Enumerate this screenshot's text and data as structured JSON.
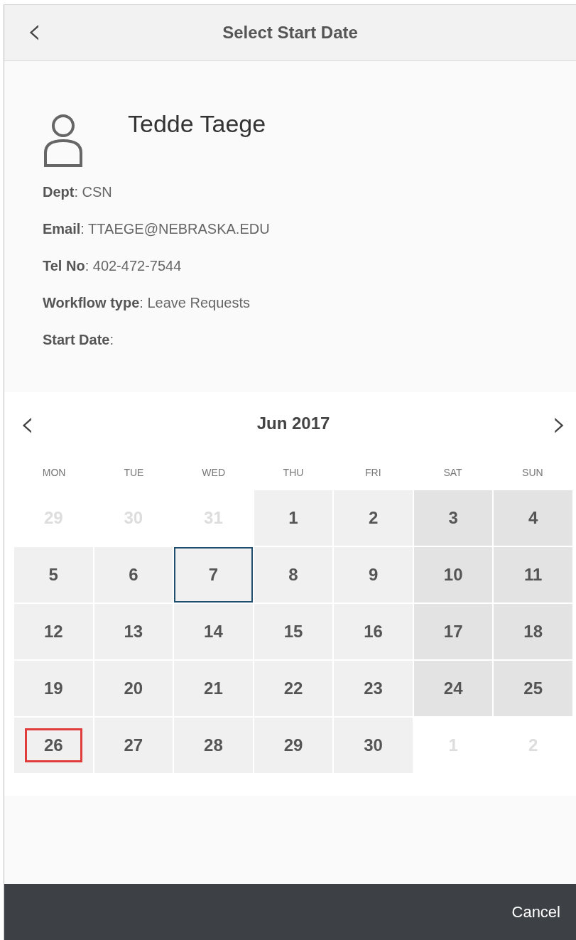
{
  "header": {
    "back": "‹",
    "title": "Select Start Date"
  },
  "profile": {
    "name": "Tedde Taege",
    "fields": [
      {
        "text": "**Dept**: CSN"
      },
      {
        "text": "**Email**: TTAEGE@NEBRASKA.EDU"
      },
      {
        "text": "**Tel No**: 402-472-7544"
      },
      {
        "text": "**Workflow type**: Leave Requests"
      },
      {
        "text": "**Start Date**:"
      }
    ]
  },
  "calendar": {
    "prev": "‹",
    "title": "Jun 2017",
    "next": "›",
    "weekdays": [
      "MON",
      "TUE",
      "WED",
      "THU",
      "FRI",
      "SAT",
      "SUN"
    ],
    "weeks": [
      [
        {
          "label": "29",
          "kind": "outside",
          "today": false,
          "highlighted": false
        },
        {
          "label": "30",
          "kind": "outside",
          "today": false,
          "highlighted": false
        },
        {
          "label": "31",
          "kind": "outside",
          "today": false,
          "highlighted": false
        },
        {
          "label": "1",
          "kind": "weekday",
          "today": false,
          "highlighted": false
        },
        {
          "label": "2",
          "kind": "weekday",
          "today": false,
          "highlighted": false
        },
        {
          "label": "3",
          "kind": "weekend",
          "today": false,
          "highlighted": false
        },
        {
          "label": "4",
          "kind": "weekend",
          "today": false,
          "highlighted": false
        }
      ],
      [
        {
          "label": "5",
          "kind": "weekday",
          "today": false,
          "highlighted": false
        },
        {
          "label": "6",
          "kind": "weekday",
          "today": false,
          "highlighted": false
        },
        {
          "label": "7",
          "kind": "weekday",
          "today": true,
          "highlighted": false
        },
        {
          "label": "8",
          "kind": "weekday",
          "today": false,
          "highlighted": false
        },
        {
          "label": "9",
          "kind": "weekday",
          "today": false,
          "highlighted": false
        },
        {
          "label": "10",
          "kind": "weekend",
          "today": false,
          "highlighted": false
        },
        {
          "label": "11",
          "kind": "weekend",
          "today": false,
          "highlighted": false
        }
      ],
      [
        {
          "label": "12",
          "kind": "weekday",
          "today": false,
          "highlighted": false
        },
        {
          "label": "13",
          "kind": "weekday",
          "today": false,
          "highlighted": false
        },
        {
          "label": "14",
          "kind": "weekday",
          "today": false,
          "highlighted": false
        },
        {
          "label": "15",
          "kind": "weekday",
          "today": false,
          "highlighted": false
        },
        {
          "label": "16",
          "kind": "weekday",
          "today": false,
          "highlighted": false
        },
        {
          "label": "17",
          "kind": "weekend",
          "today": false,
          "highlighted": false
        },
        {
          "label": "18",
          "kind": "weekend",
          "today": false,
          "highlighted": false
        }
      ],
      [
        {
          "label": "19",
          "kind": "weekday",
          "today": false,
          "highlighted": false
        },
        {
          "label": "20",
          "kind": "weekday",
          "today": false,
          "highlighted": false
        },
        {
          "label": "21",
          "kind": "weekday",
          "today": false,
          "highlighted": false
        },
        {
          "label": "22",
          "kind": "weekday",
          "today": false,
          "highlighted": false
        },
        {
          "label": "23",
          "kind": "weekday",
          "today": false,
          "highlighted": false
        },
        {
          "label": "24",
          "kind": "weekend",
          "today": false,
          "highlighted": false
        },
        {
          "label": "25",
          "kind": "weekend",
          "today": false,
          "highlighted": false
        }
      ],
      [
        {
          "label": "26",
          "kind": "weekday",
          "today": false,
          "highlighted": true
        },
        {
          "label": "27",
          "kind": "weekday",
          "today": false,
          "highlighted": false
        },
        {
          "label": "28",
          "kind": "weekday",
          "today": false,
          "highlighted": false
        },
        {
          "label": "29",
          "kind": "weekday",
          "today": false,
          "highlighted": false
        },
        {
          "label": "30",
          "kind": "weekday",
          "today": false,
          "highlighted": false
        },
        {
          "label": "1",
          "kind": "outside",
          "today": false,
          "highlighted": false
        },
        {
          "label": "2",
          "kind": "outside",
          "today": false,
          "highlighted": false
        }
      ]
    ]
  },
  "footer": {
    "cancel": "Cancel"
  }
}
